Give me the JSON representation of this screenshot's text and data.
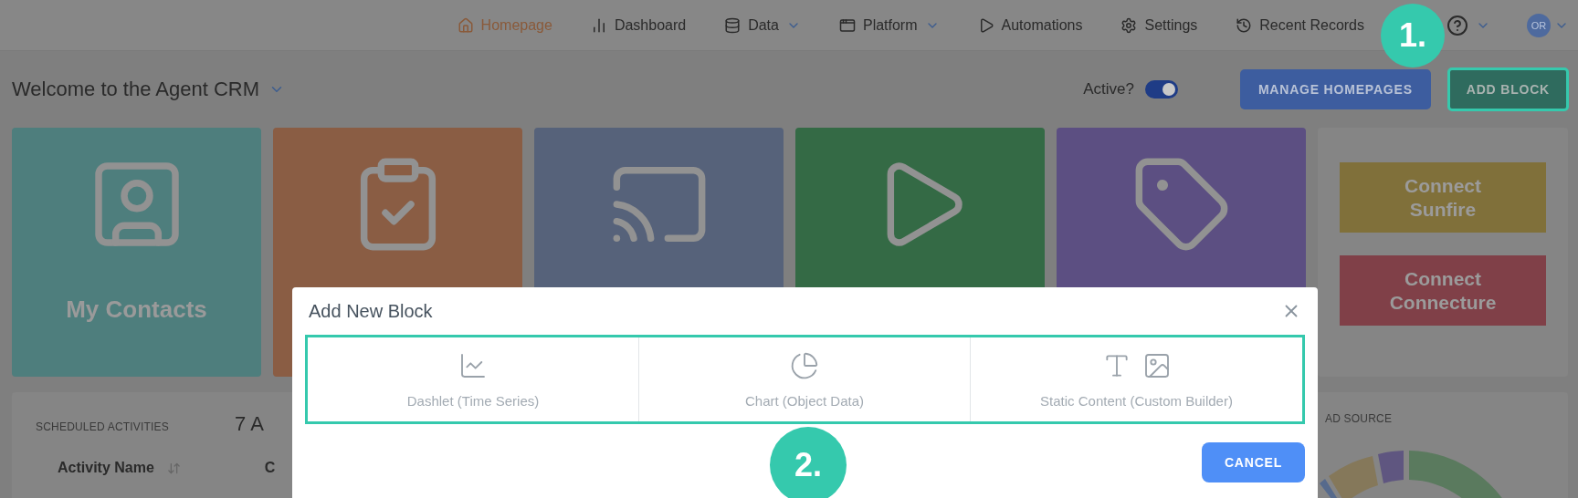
{
  "nav": {
    "items": [
      {
        "label": "Homepage",
        "selected": true,
        "has_menu": false
      },
      {
        "label": "Dashboard",
        "selected": false,
        "has_menu": false
      },
      {
        "label": "Data",
        "selected": false,
        "has_menu": true
      },
      {
        "label": "Platform",
        "selected": false,
        "has_menu": true
      },
      {
        "label": "Automations",
        "selected": false,
        "has_menu": false
      },
      {
        "label": "Settings",
        "selected": false,
        "has_menu": false
      },
      {
        "label": "Recent Records",
        "selected": false,
        "has_menu": false
      }
    ],
    "help_has_menu": true,
    "avatar": "OR",
    "avatar_has_menu": true
  },
  "header": {
    "title": "Welcome to the Agent CRM",
    "active_label": "Active?",
    "active_on": true,
    "buttons": [
      {
        "label": "MANAGE HOMEPAGES",
        "kind": "primary"
      },
      {
        "label": "ADD BLOCK",
        "kind": "highlighted"
      }
    ]
  },
  "tiles": [
    {
      "label": "My Contacts",
      "color": "#4e7e7d"
    },
    {
      "color": "#8a5d44"
    },
    {
      "color": "#56627a"
    },
    {
      "color": "#346a45"
    },
    {
      "color": "#5c4f82"
    }
  ],
  "connect_buttons": [
    {
      "label": "Connect Sunfire",
      "color": "#80703a"
    },
    {
      "label": "Connect Connecture",
      "color": "#804048"
    }
  ],
  "activities": {
    "title": "SCHEDULED ACTIVITIES",
    "count": "7 A",
    "columns": [
      "Activity Name",
      "C"
    ]
  },
  "lead_source": {
    "title": "AD SOURCE"
  },
  "modal": {
    "title": "Add New Block",
    "options": [
      {
        "label": "Dashlet (Time Series)"
      },
      {
        "label": "Chart (Object Data)"
      },
      {
        "label": "Static Content (Custom Builder)"
      }
    ],
    "cancel": "CANCEL"
  },
  "annotations": [
    "1.",
    "2."
  ]
}
